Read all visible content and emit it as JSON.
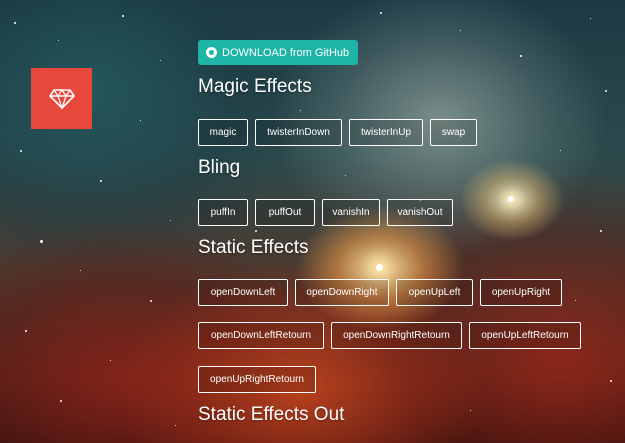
{
  "github_button": {
    "label": "DOWNLOAD from GitHub",
    "icon": "github-icon",
    "color": "#1fb5a6"
  },
  "logo": {
    "icon": "diamond-icon",
    "color": "#e8483c"
  },
  "sections": {
    "magic": {
      "title": "Magic Effects",
      "buttons": [
        "magic",
        "twisterInDown",
        "twisterInUp",
        "swap"
      ]
    },
    "bling": {
      "title": "Bling",
      "buttons": [
        "puffIn",
        "puffOut",
        "vanishIn",
        "vanishOut"
      ]
    },
    "static_effects": {
      "title": "Static Effects",
      "buttons": [
        "openDownLeft",
        "openDownRight",
        "openUpLeft",
        "openUpRight",
        "openDownLeftRetourn",
        "openDownRightRetourn",
        "openUpLeftRetourn",
        "openUpRightRetourn"
      ]
    },
    "static_effects_out": {
      "title": "Static Effects Out"
    }
  }
}
